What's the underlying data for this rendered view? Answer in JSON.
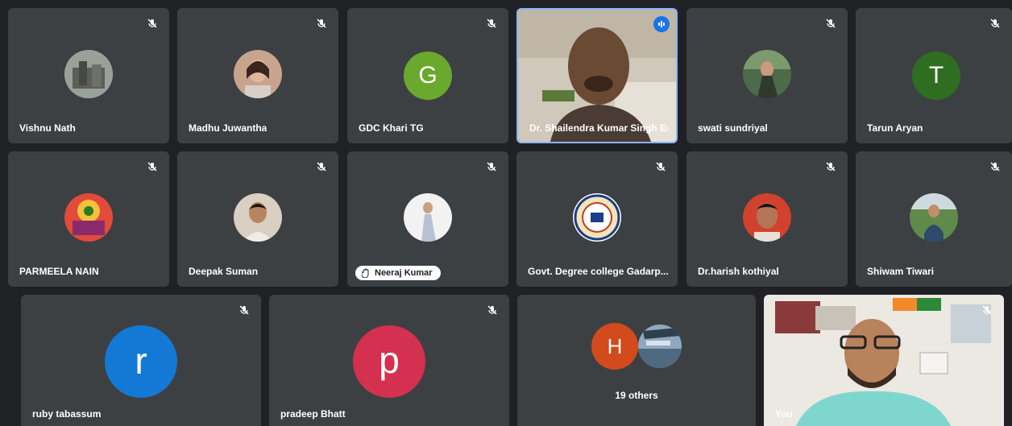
{
  "participants": {
    "p1": {
      "name": "Vishnu Nath"
    },
    "p2": {
      "name": "Madhu Juwantha"
    },
    "p3": {
      "name": "GDC Khari TG",
      "initial": "G",
      "color": "#6aa82e"
    },
    "p4": {
      "name": "Dr. Shailendra Kumar Singh Ec..."
    },
    "p5": {
      "name": "swati sundriyal"
    },
    "p6": {
      "name": "Tarun Aryan",
      "initial": "T",
      "color": "#2f6e21"
    },
    "p7": {
      "name": "PARMEELA NAIN"
    },
    "p8": {
      "name": "Deepak Suman"
    },
    "p9": {
      "name": "Neeraj Kumar"
    },
    "p10": {
      "name": "Govt. Degree college Gadarp..."
    },
    "p11": {
      "name": "Dr.harish kothiyal"
    },
    "p12": {
      "name": "Shiwam Tiwari"
    },
    "p13": {
      "name": "ruby tabassum",
      "initial": "r",
      "color": "#1479d4"
    },
    "p14": {
      "name": "pradeep Bhatt",
      "initial": "p",
      "color": "#d4304f"
    },
    "others": {
      "label": "19 others",
      "initial": "H",
      "color": "#d34a1c"
    },
    "self": {
      "name": "You"
    }
  },
  "colors": {
    "background": "#202124",
    "tile": "#3c4043",
    "active_speaker_border": "#8ab4f8",
    "speaking_badge": "#1a73e8"
  }
}
